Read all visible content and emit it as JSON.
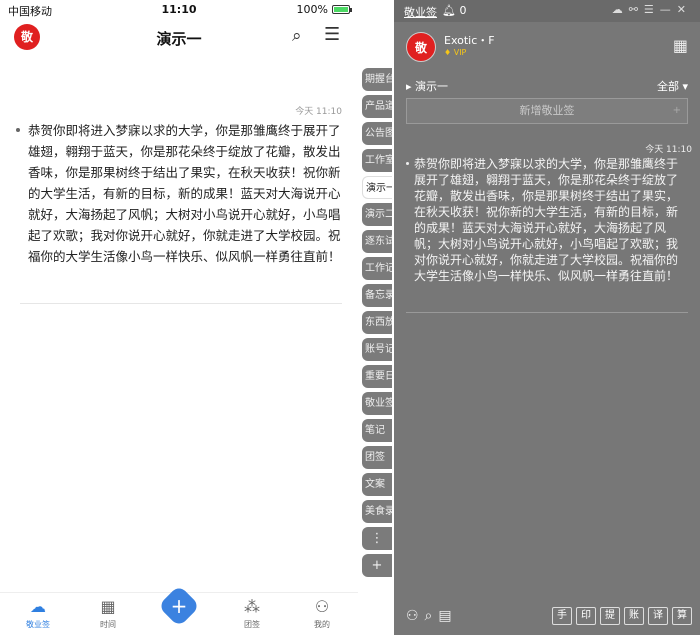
{
  "phone": {
    "status": {
      "carrier": "中国移动",
      "time": "11:10",
      "battery": "100%"
    },
    "header": {
      "logo": "敬",
      "title": "演示一",
      "search_icon": "search-icon",
      "menu_icon": "menu-icon"
    },
    "note": {
      "time": "今天 11:10",
      "text": "恭贺你即将进入梦寐以求的大学，你是那雏鹰终于展开了雄翅，翱翔于蓝天，你是那花朵终于绽放了花瓣，散发出香味，你是那果树终于结出了果实，在秋天收获！祝你新的大学生活，有新的目标，新的成果！蓝天对大海说开心就好，大海扬起了风帆；大树对小鸟说开心就好，小鸟唱起了欢歌；我对你说开心就好，你就走进了大学校园。祝福你的大学生活像小鸟一样快乐、似风帆一样勇往直前！"
    },
    "side_tabs": [
      {
        "label": "期握台",
        "active": false
      },
      {
        "label": "产品道",
        "active": false
      },
      {
        "label": "公告图",
        "active": false
      },
      {
        "label": "工作室",
        "active": false
      },
      {
        "label": "演示一",
        "active": true
      },
      {
        "label": "演示二",
        "active": false
      },
      {
        "label": "逐东试",
        "active": false
      },
      {
        "label": "工作记",
        "active": false
      },
      {
        "label": "备忘录",
        "active": false
      },
      {
        "label": "东西放",
        "active": false
      },
      {
        "label": "账号记",
        "active": false
      },
      {
        "label": "重要日",
        "active": false
      },
      {
        "label": "敬业签",
        "active": false
      },
      {
        "label": "笔记",
        "active": false
      },
      {
        "label": "团签",
        "active": false
      },
      {
        "label": "文案",
        "active": false
      },
      {
        "label": "美食录",
        "active": false
      },
      {
        "label": "⋮",
        "active": false
      },
      {
        "label": "+",
        "active": false
      }
    ],
    "tabbar": [
      {
        "label": "敬业签",
        "icon": "cloud-icon",
        "active": true
      },
      {
        "label": "时间",
        "icon": "calendar-icon",
        "active": false
      },
      {
        "label": "",
        "icon": "plus-icon",
        "active": false
      },
      {
        "label": "团签",
        "icon": "group-icon",
        "active": false
      },
      {
        "label": "我的",
        "icon": "user-icon",
        "active": false
      }
    ]
  },
  "desktop": {
    "title": "敬业签",
    "notifications": "0",
    "user": {
      "logo": "敬",
      "name": "Exotic・F",
      "badge": "VIP"
    },
    "folder": {
      "name": "演示一",
      "filter": "全部"
    },
    "new_note": {
      "placeholder": "新增敬业签",
      "add_label": "+"
    },
    "note": {
      "time": "今天 11:10",
      "text": "恭贺你即将进入梦寐以求的大学，你是那雏鹰终于展开了雄翅，翱翔于蓝天，你是那花朵终于绽放了花瓣，散发出香味，你是那果树终于结出了果实，在秋天收获！祝你新的大学生活，有新的目标，新的成果！蓝天对大海说开心就好，大海扬起了风帆；大树对小鸟说开心就好，小鸟唱起了欢歌；我对你说开心就好，你就走进了大学校园。祝福你的大学生活像小鸟一样快乐、似风帆一样勇往直前！"
    },
    "tools": [
      "手",
      "印",
      "提",
      "账",
      "译",
      "算"
    ]
  }
}
